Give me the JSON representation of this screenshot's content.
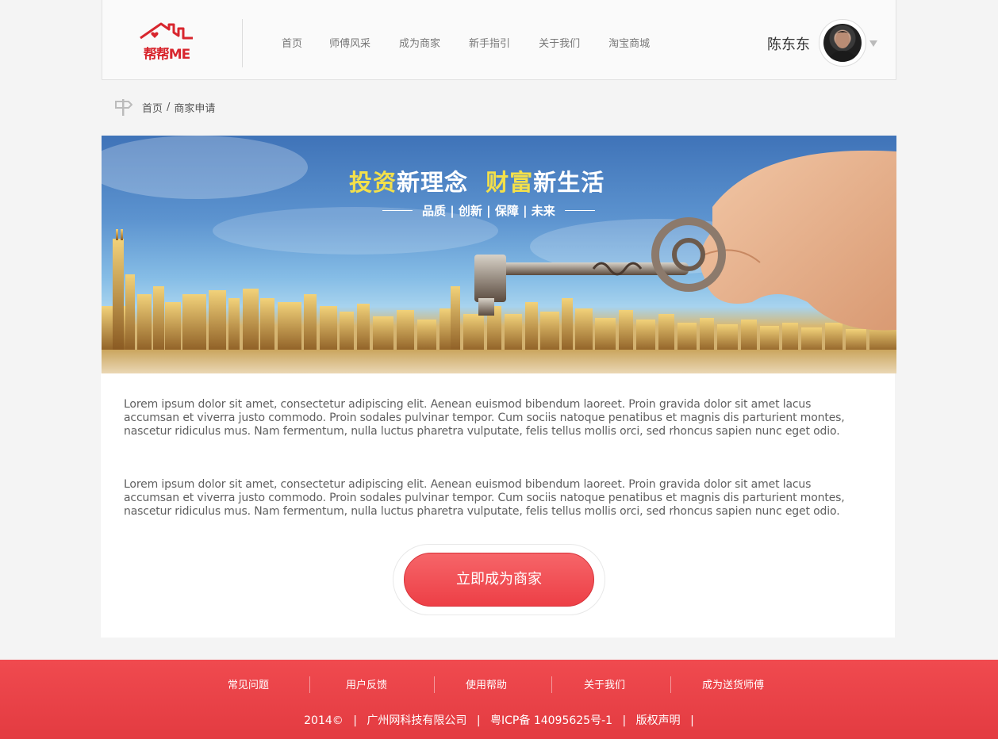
{
  "header": {
    "logo_text": "帮帮ME",
    "nav": [
      "首页",
      "师傅风采",
      "成为商家",
      "新手指引",
      "关于我们",
      "淘宝商城"
    ],
    "user_name": "陈东东"
  },
  "breadcrumb": {
    "home": "首页",
    "separator": "/",
    "current": "商家申请"
  },
  "banner": {
    "title_part1_highlight": "投资",
    "title_part1": "新理念",
    "title_part2_highlight": "财富",
    "title_part2": "新生活",
    "subtitle": "品质 | 创新 | 保障 | 未来"
  },
  "content": {
    "paragraph1": "Lorem ipsum dolor sit amet, consectetur adipiscing elit. Aenean euismod bibendum laoreet. Proin gravida dolor sit amet lacus accumsan et viverra justo commodo. Proin sodales pulvinar tempor. Cum sociis natoque penatibus et magnis dis parturient montes, nascetur ridiculus mus. Nam fermentum, nulla luctus pharetra vulputate, felis tellus mollis orci, sed rhoncus sapien nunc eget odio.",
    "paragraph2": "Lorem ipsum dolor sit amet, consectetur adipiscing elit. Aenean euismod bibendum laoreet. Proin gravida dolor sit amet lacus accumsan et viverra justo commodo. Proin sodales pulvinar tempor. Cum sociis natoque penatibus et magnis dis parturient montes, nascetur ridiculus mus. Nam fermentum, nulla luctus pharetra vulputate, felis tellus mollis orci, sed rhoncus sapien nunc eget odio.",
    "cta_label": "立即成为商家"
  },
  "footer": {
    "links": [
      "常见问题",
      "用户反馈",
      "使用帮助",
      "关于我们",
      "成为送货师傅"
    ],
    "year": "2014©",
    "company": "广州网科技有限公司",
    "icp": "粤ICP备 14095625号-1",
    "copyright": "版权声明",
    "separator": "|"
  },
  "colors": {
    "brand_red": "#e8434a",
    "logo_red": "#d8262e",
    "banner_highlight": "#f3e04a"
  },
  "icons": [
    "house-logo-icon",
    "signpost-icon",
    "dropdown-arrow-icon",
    "key-icon"
  ]
}
